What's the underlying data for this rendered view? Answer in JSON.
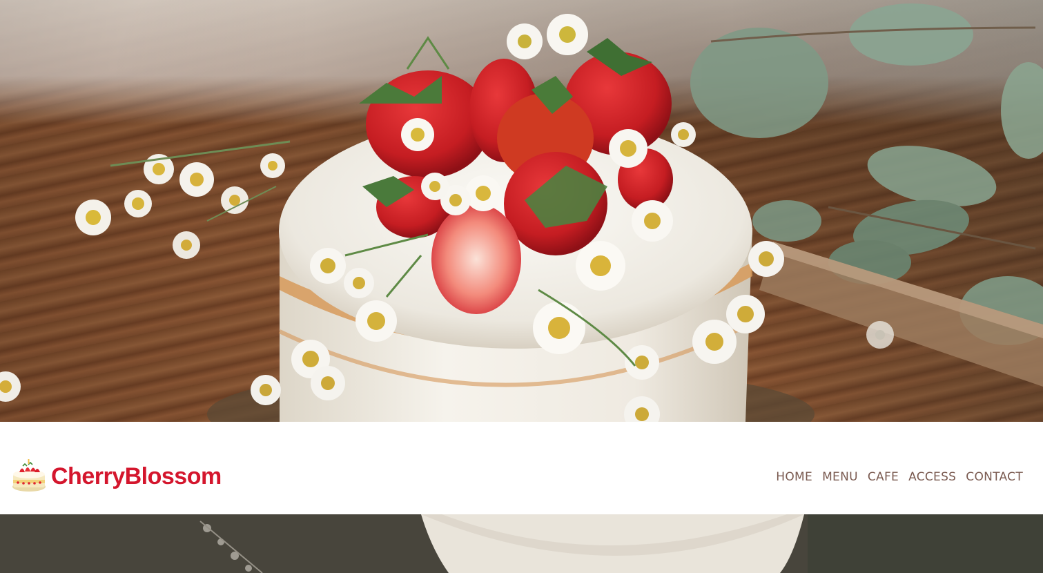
{
  "colors": {
    "brand_red": "#d4162d",
    "nav_text": "#7a5a50",
    "header_bg": "#ffffff"
  },
  "hero": {
    "image_icon": "strawberry-cake-photo"
  },
  "header": {
    "logo_icon": "strawberry-cake-icon",
    "brand_name": "CherryBlossom",
    "nav": [
      {
        "label": "HOME"
      },
      {
        "label": "MENU"
      },
      {
        "label": "CAFE"
      },
      {
        "label": "ACCESS"
      },
      {
        "label": "CONTACT"
      }
    ]
  },
  "next_section": {
    "image_icon": "cake-photo"
  }
}
